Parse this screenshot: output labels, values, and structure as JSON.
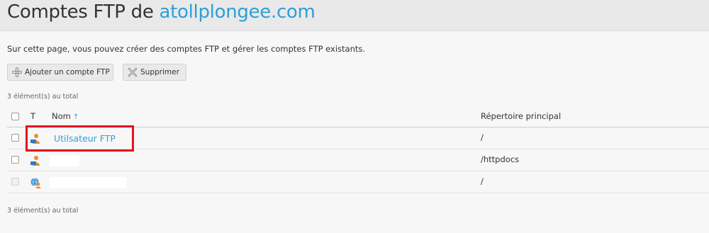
{
  "header": {
    "title_prefix": "Comptes FTP de ",
    "domain": "atollplongee.com"
  },
  "intro_text": "Sur cette page, vous pouvez créer des comptes FTP et gérer les comptes FTP existants.",
  "toolbar": {
    "add_label": "Ajouter un compte FTP",
    "delete_label": "Supprimer"
  },
  "count_label": "3 élément(s) au total",
  "table": {
    "headers": {
      "type": "T",
      "name": "Nom",
      "sort_arrow": "↑",
      "directory": "Répertoire principal"
    },
    "rows": [
      {
        "name": "Utilsateur FTP",
        "directory": "/",
        "icon": "ftp-user-icon",
        "checkbox_enabled": true,
        "name_redacted": false
      },
      {
        "name": "",
        "directory": "/httpdocs",
        "icon": "ftp-user-icon",
        "checkbox_enabled": true,
        "name_redacted": true
      },
      {
        "name": "",
        "directory": "/",
        "icon": "web-user-icon",
        "checkbox_enabled": false,
        "name_redacted": true
      }
    ]
  },
  "colors": {
    "accent": "#2e9fd6",
    "highlight": "#e1141e"
  }
}
